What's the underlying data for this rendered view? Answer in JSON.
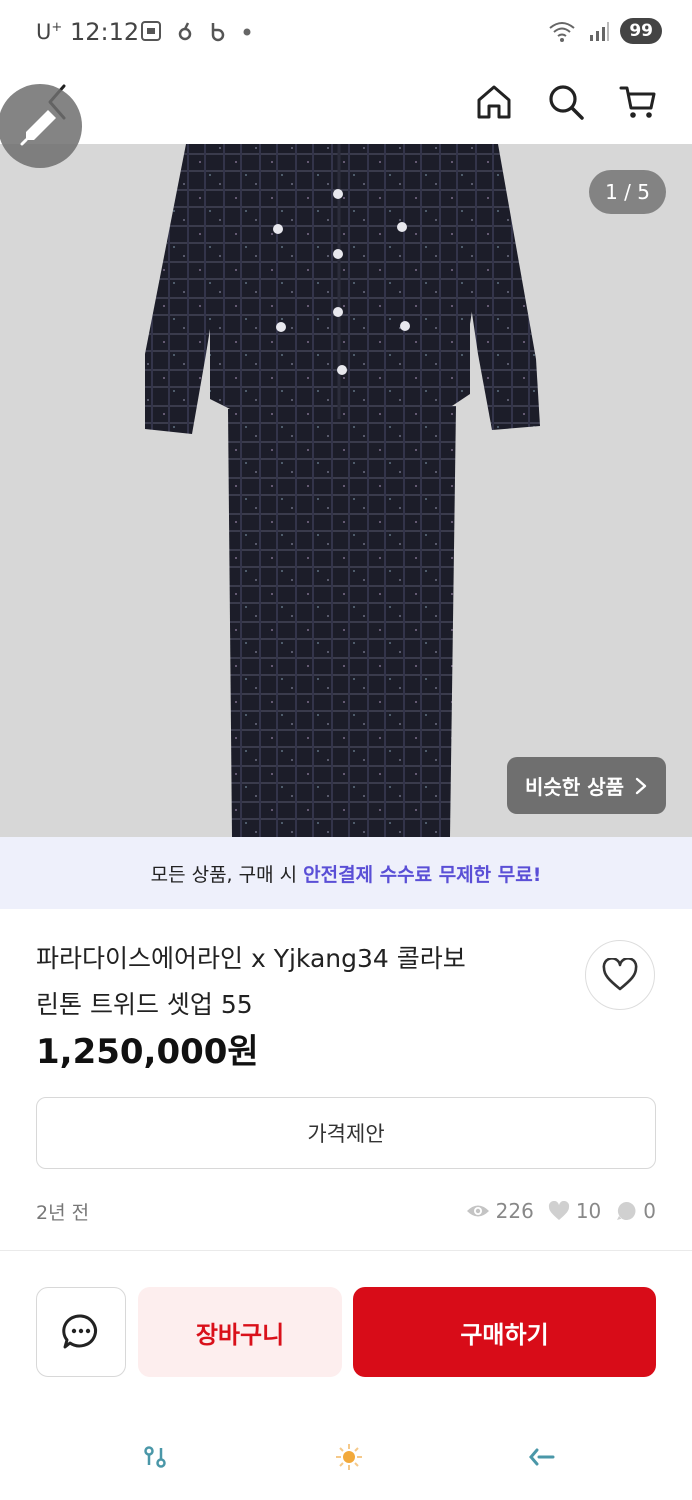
{
  "status_bar": {
    "carrier": "U",
    "carrier_sup": "+",
    "time": "12:12",
    "battery": "99"
  },
  "image": {
    "counter": "1 / 5",
    "similar_label": "비슷한 상품"
  },
  "promo": {
    "text": "모든 상품, 구매 시",
    "highlight": "안전결제 수수료 무제한 무료!"
  },
  "product": {
    "title_line1": "파라다이스에어라인 x Yjkang34 콜라보",
    "title_line2": "린톤 트위드 셋업 55",
    "price": "1,250,000원"
  },
  "actions": {
    "offer_label": "가격제안",
    "cart_label": "장바구니",
    "buy_label": "구매하기"
  },
  "meta": {
    "posted": "2년 전",
    "views": "226",
    "likes": "10",
    "comments": "0"
  },
  "colors": {
    "accent_red": "#d80c18",
    "promo_purple": "#5a4fd6",
    "promo_bg": "#eef0fb"
  }
}
